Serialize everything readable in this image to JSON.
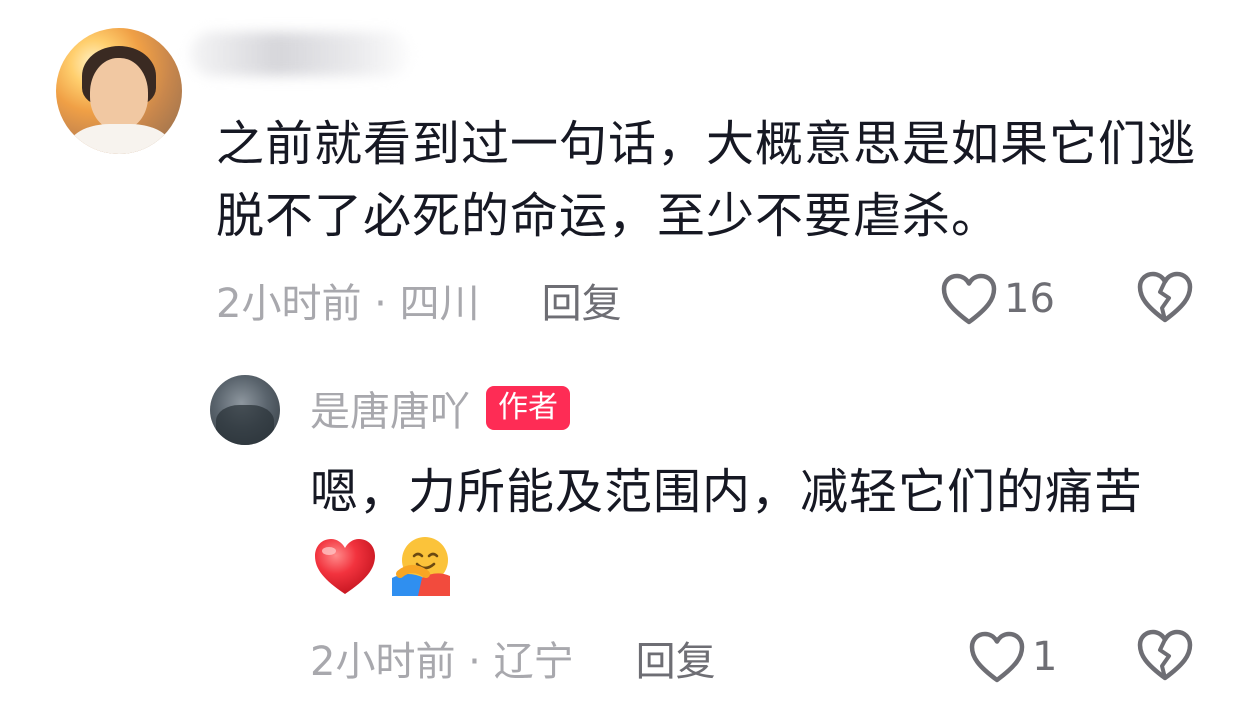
{
  "comment": {
    "text": "之前就看到过一句话，大概意思是如果它们逃脱不了必死的命运，至少不要虐杀。",
    "time_location": "2小时前 · 四川",
    "reply_label": "回复",
    "like_count": "16",
    "avatar_icon": "user-avatar-photo",
    "like_icon": "heart-outline-icon",
    "dislike_icon": "broken-heart-icon"
  },
  "reply": {
    "author_name": "是唐唐吖",
    "author_badge": "作者",
    "text": "嗯，力所能及范围内，减轻它们的痛苦",
    "emojis": [
      "red-heart-emoji",
      "hugging-face-emoji"
    ],
    "time_location": "2小时前 · 辽宁",
    "reply_label": "回复",
    "like_count": "1",
    "avatar_icon": "author-avatar-photo",
    "like_icon": "heart-outline-icon",
    "dislike_icon": "broken-heart-icon"
  },
  "colors": {
    "badge": "#fe2c55",
    "text": "#161823",
    "meta": "#a8a8ad",
    "icon": "#6e6e74"
  }
}
